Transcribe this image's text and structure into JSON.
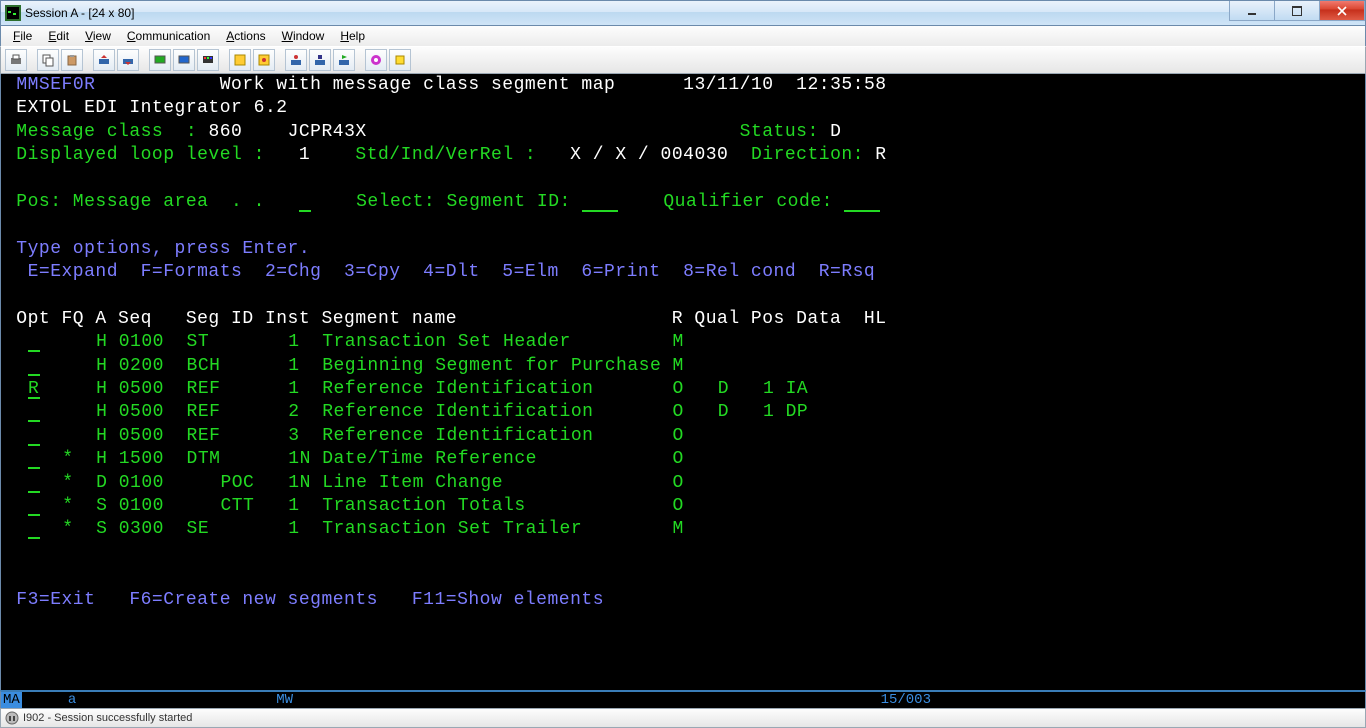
{
  "window": {
    "title": "Session A - [24 x 80]"
  },
  "menu": {
    "items": [
      "File",
      "Edit",
      "View",
      "Communication",
      "Actions",
      "Window",
      "Help"
    ]
  },
  "terminal": {
    "program_id": "MMSEF0R",
    "screen_title": "Work with message class segment map",
    "date": "13/11/10",
    "time": "12:35:58",
    "product_line": "EXTOL EDI Integrator 6.2",
    "msg_class_label": "Message class  :",
    "msg_class_value": "860",
    "msg_class_name": "JCPR43X",
    "status_label": "Status:",
    "status_value": "D",
    "loop_label": "Displayed loop level :",
    "loop_value": "1",
    "std_label": "Std/Ind/VerRel :",
    "std_value": "X / X / 004030",
    "dir_label": "Direction:",
    "dir_value": "R",
    "pos_label": "Pos: Message area",
    "select_label": "Select: Segment ID:",
    "qual_code_label": "Qualifier code:",
    "type_options": "Type options, press Enter.",
    "options_help": "  E=Expand  F=Formats  2=Chg  3=Cpy  4=Dlt  5=Elm  6=Print  8=Rel cond  R=Rsq",
    "headers": {
      "opt": "Opt",
      "fq": "FQ",
      "a": "A",
      "seq": "Seq",
      "segid": "Seg ID",
      "inst": "Inst",
      "segname": "Segment name",
      "r": "R",
      "qual": "Qual",
      "pos": "Pos",
      "data": "Data",
      "hl": "HL"
    },
    "rows": [
      {
        "opt": "",
        "fq": "",
        "a": "H",
        "seq": "0100",
        "segid": "ST ",
        "inst": " 1 ",
        "segname": "Transaction Set Header        ",
        "r": "M",
        "qual": "",
        "pos": "",
        "data": ""
      },
      {
        "opt": "",
        "fq": "",
        "a": "H",
        "seq": "0200",
        "segid": "BCH",
        "inst": " 1 ",
        "segname": "Beginning Segment for Purchase",
        "r": "M",
        "qual": "",
        "pos": "",
        "data": ""
      },
      {
        "opt": "R",
        "fq": "",
        "a": "H",
        "seq": "0500",
        "segid": "REF",
        "inst": " 1 ",
        "segname": "Reference Identification      ",
        "r": "O",
        "qual": "D",
        "pos": "1",
        "data": "IA"
      },
      {
        "opt": "",
        "fq": "",
        "a": "H",
        "seq": "0500",
        "segid": "REF",
        "inst": " 2 ",
        "segname": "Reference Identification      ",
        "r": "O",
        "qual": "D",
        "pos": "1",
        "data": "DP"
      },
      {
        "opt": "",
        "fq": "",
        "a": "H",
        "seq": "0500",
        "segid": "REF",
        "inst": " 3 ",
        "segname": "Reference Identification      ",
        "r": "O",
        "qual": "",
        "pos": "",
        "data": ""
      },
      {
        "opt": "",
        "fq": "*",
        "a": "H",
        "seq": "1500",
        "segid": "DTM",
        "inst": " 1N",
        "segname": "Date/Time Reference           ",
        "r": "O",
        "qual": "",
        "pos": "",
        "data": ""
      },
      {
        "opt": "",
        "fq": "*",
        "a": "D",
        "seq": "0100",
        "segid": "   POC",
        "inst": " 1N",
        "segname": "Line Item Change              ",
        "r": "O",
        "qual": "",
        "pos": "",
        "data": ""
      },
      {
        "opt": "",
        "fq": "*",
        "a": "S",
        "seq": "0100",
        "segid": "   CTT",
        "inst": " 1 ",
        "segname": "Transaction Totals            ",
        "r": "O",
        "qual": "",
        "pos": "",
        "data": ""
      },
      {
        "opt": "",
        "fq": "*",
        "a": "S",
        "seq": "0300",
        "segid": "SE ",
        "inst": " 1 ",
        "segname": "Transaction Set Trailer       ",
        "r": "M",
        "qual": "",
        "pos": "",
        "data": ""
      }
    ],
    "fkeys": "F3=Exit   F6=Create new segments   F11=Show elements"
  },
  "oia": {
    "ma": "MA",
    "a": "a",
    "mw": "MW",
    "cursor": "15/003"
  },
  "statusbar": {
    "msg": "I902 - Session successfully started"
  }
}
